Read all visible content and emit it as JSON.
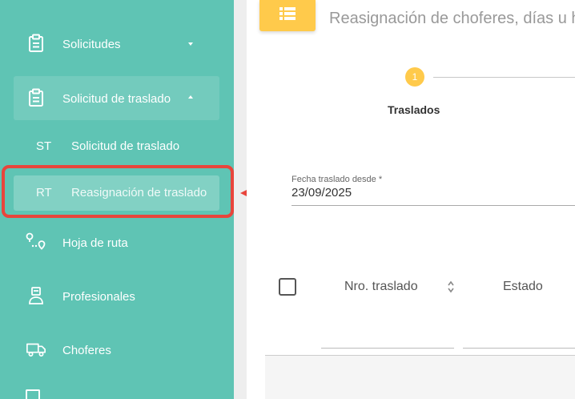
{
  "sidebar": {
    "items": [
      {
        "label": "Solicitudes",
        "icon": "clipboard-icon",
        "expanded": false
      },
      {
        "label": "Solicitud de traslado",
        "icon": "clipboard-icon",
        "expanded": true
      },
      {
        "label": "Hoja de ruta",
        "icon": "route-icon"
      },
      {
        "label": "Profesionales",
        "icon": "professional-icon"
      },
      {
        "label": "Choferes",
        "icon": "van-icon"
      }
    ],
    "sub_items": [
      {
        "abbr": "ST",
        "label": "Solicitud de traslado",
        "selected": false
      },
      {
        "abbr": "RT",
        "label": "Reasignación de traslado",
        "selected": true
      }
    ]
  },
  "main": {
    "title": "Reasignación de choferes, días u h",
    "title_icon": "list-icon",
    "stepper": {
      "step_number": "1",
      "step_label": "Traslados"
    },
    "date_field": {
      "label": "Fecha traslado desde *",
      "value": "23/09/2025"
    },
    "table": {
      "columns": [
        "Nro. traslado",
        "Estado"
      ]
    }
  },
  "colors": {
    "sidebar_bg": "#5fc4b4",
    "accent": "#ffca4b",
    "annotation": "#e8453c"
  }
}
